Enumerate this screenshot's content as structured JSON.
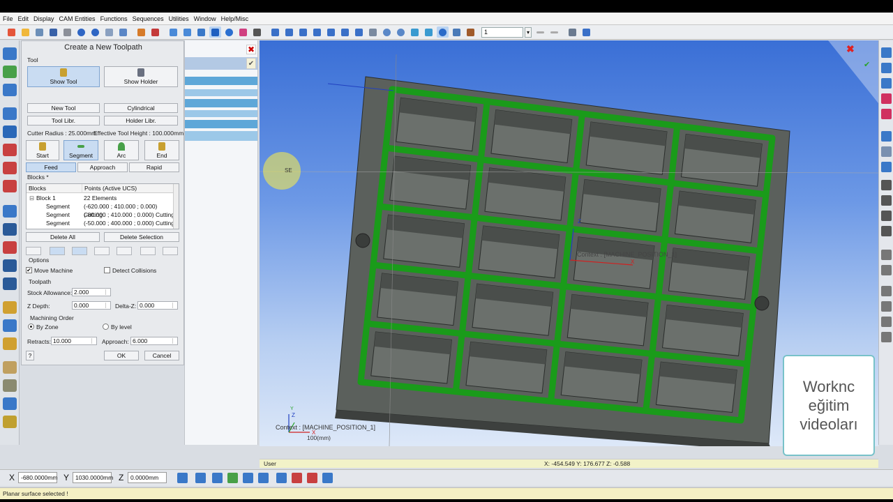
{
  "menu": [
    "File",
    "Edit",
    "Display",
    "CAM Entities",
    "Functions",
    "Sequences",
    "Utilities",
    "Window",
    "Help/Misc"
  ],
  "toolbar": {
    "combo_value": "1"
  },
  "dialog": {
    "title": "Create a New Toolpath",
    "tool_group": "Tool",
    "show_tool": "Show Tool",
    "show_holder": "Show Holder",
    "new_tool": "New Tool",
    "cylindrical": "Cylindrical",
    "tool_libr": "Tool Libr.",
    "holder_libr": "Holder Libr.",
    "cutter_radius": "Cutter Radius : 25.000mm",
    "effective_height": "Effective Tool Height : 100.000mm",
    "start": "Start",
    "segment": "Segment",
    "arc": "Arc",
    "end": "End",
    "feed": "Feed",
    "approach_btn": "Approach",
    "rapid": "Rapid",
    "blocks_label": "Blocks *",
    "blocks_header_col1": "Blocks",
    "blocks_header_col2": "Points (Active UCS)",
    "rows": [
      {
        "name": "Block 1",
        "value": "22 Elements"
      },
      {
        "name": "Segment",
        "value": "(-620.000 ; 410.000 ; 0.000) Cutting"
      },
      {
        "name": "Segment",
        "value": "(-80.000 ; 410.000 ; 0.000) Cutting"
      },
      {
        "name": "Segment",
        "value": "(-50.000 ; 400.000 ; 0.000) Cutting"
      }
    ],
    "block_toggle": "⊟",
    "delete_all": "Delete All",
    "delete_selection": "Delete Selection",
    "options_label": "Options",
    "move_machine": "Move Machine",
    "move_machine_mark": "✔",
    "detect_collisions": "Detect Collisions",
    "toolpath_label": "Toolpath",
    "stock_allowance_label": "Stock Allowance:",
    "stock_allowance": "2.000",
    "z_depth_label": "Z Depth:",
    "z_depth": "0.000",
    "delta_z_label": "Delta-Z:",
    "delta_z": "0.000",
    "machining_order_label": "Machining Order",
    "by_zone": "By Zone",
    "by_level": "By level",
    "retracts_label": "Retracts:",
    "retracts": "10.000",
    "approach_label": "Approach:",
    "approach": "6.000",
    "help": "?",
    "ok": "OK",
    "cancel": "Cancel"
  },
  "midpanel": {
    "close_glyph": "✖",
    "check_glyph": "✔"
  },
  "viewport": {
    "close_glyph": "✖",
    "check_glyph": "✔",
    "se_label": "SE",
    "context_3d": "Context : [MACHINE_POSITION_1]",
    "context": "Context : [MACHINE_POSITION_1]",
    "scale": "100(mm)",
    "axis_x": "X",
    "axis_y": "Y",
    "axis_z": "Z",
    "axis3d_z": "Z",
    "axis3d_x": "X",
    "part_color": "#5b605c",
    "toolpath_color": "#1a9b1a"
  },
  "status": {
    "user": "User",
    "coords": "X: -454.549   Y: 176.677   Z:   -0.588"
  },
  "coordbar": {
    "x_label": "X",
    "x_value": "-680.0000mm",
    "y_label": "Y",
    "y_value": "1030.0000mm",
    "z_label": "Z",
    "z_value": "0.0000mm"
  },
  "message": "Planar surface selected !",
  "watermark": {
    "line1": "Worknc",
    "line2": "eğitim",
    "line3": "videoları"
  }
}
